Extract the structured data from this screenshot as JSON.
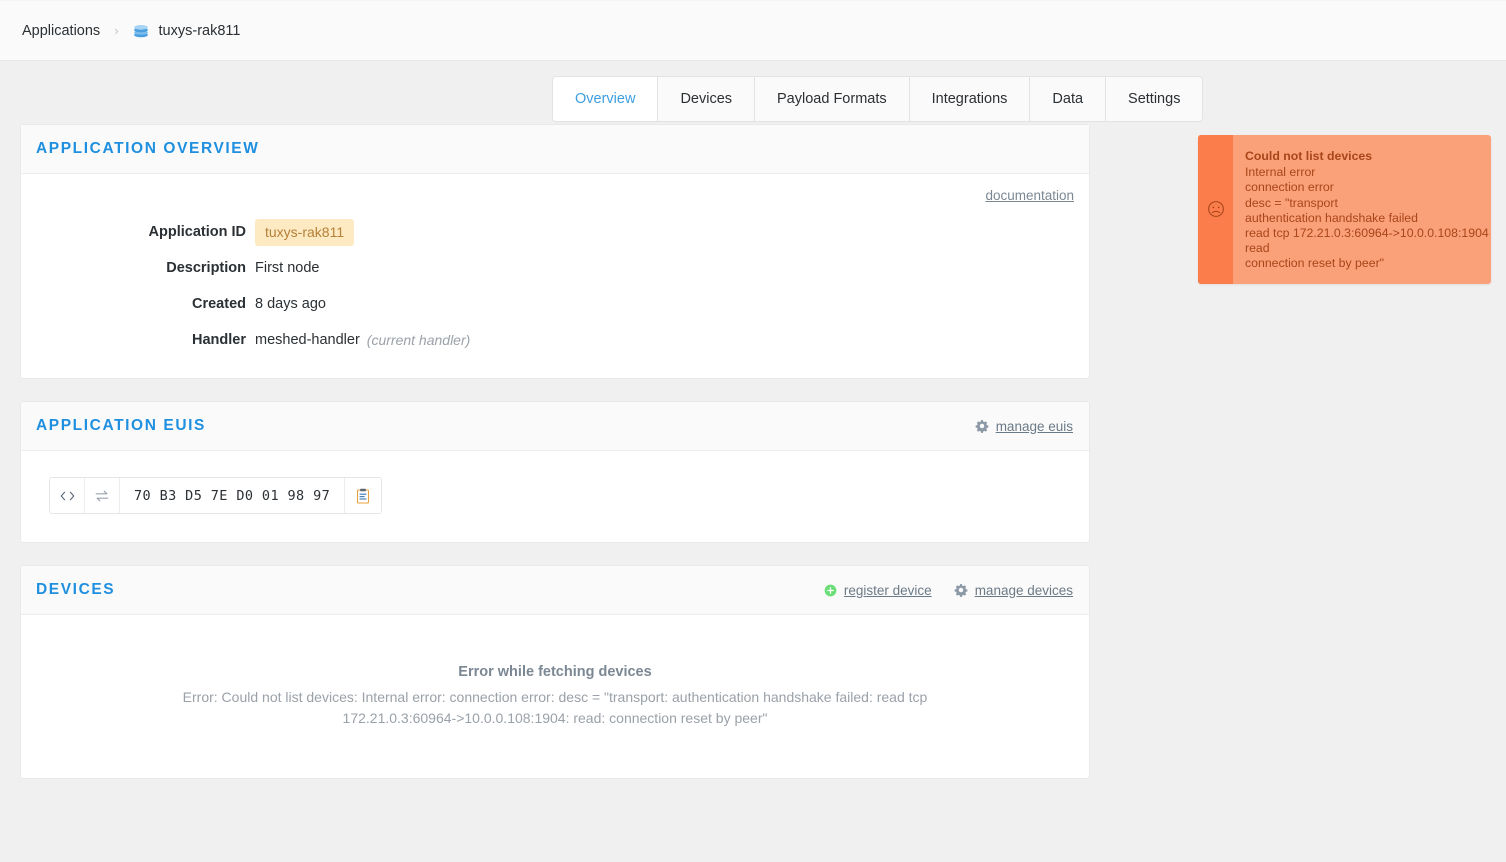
{
  "breadcrumb": {
    "root_label": "Applications",
    "separator": "›",
    "current_label": "tuxys-rak811",
    "current_icon": "layers-icon"
  },
  "tabs": [
    {
      "label": "Overview",
      "active": true
    },
    {
      "label": "Devices",
      "active": false
    },
    {
      "label": "Payload Formats",
      "active": false
    },
    {
      "label": "Integrations",
      "active": false
    },
    {
      "label": "Data",
      "active": false
    },
    {
      "label": "Settings",
      "active": false
    }
  ],
  "toast": {
    "icon": "sad-face-icon",
    "title": "Could not list devices",
    "lines": [
      "Internal error",
      "connection error",
      "desc = \"transport",
      "authentication handshake failed",
      "read tcp 172.21.0.3:60964->10.0.0.108:1904",
      "read",
      "connection reset by peer\""
    ],
    "background_color": "#fba17a",
    "accent_color": "#fa7d4b",
    "text_color": "#a8451a"
  },
  "overview_panel": {
    "title": "Application Overview",
    "documentation_link": "documentation",
    "fields": [
      {
        "key": "Application ID",
        "value": "tuxys-rak811",
        "badge": true
      },
      {
        "key": "Description",
        "value": "First node",
        "badge": false
      },
      {
        "key": "Created",
        "value": "8 days ago",
        "badge": false
      },
      {
        "key": "Handler",
        "value": "meshed-handler",
        "note": "(current handler)",
        "badge": false
      }
    ]
  },
  "euis_panel": {
    "title": "Application EUIS",
    "manage_link": {
      "label": "manage euis",
      "icon": "gear-icon"
    },
    "eui_entry": {
      "format_toggle_icon": "code-brackets-icon",
      "byte_order_icon": "swap-arrows-icon",
      "value": "70 B3 D5 7E D0 01 98 97",
      "copy_icon": "clipboard-icon"
    }
  },
  "devices_panel": {
    "title": "Devices",
    "actions": [
      {
        "label": "register device",
        "icon": "plus-circle-icon"
      },
      {
        "label": "manage devices",
        "icon": "gear-icon"
      }
    ],
    "error": {
      "title": "Error while fetching devices",
      "message": "Error: Could not list devices: Internal error: connection error: desc = \"transport: authentication handshake failed: read tcp 172.21.0.3:60964->10.0.0.108:1904: read: connection reset by peer\""
    }
  },
  "theme": {
    "page_background": "#f0f0f0",
    "panel_title_color": "#1f8fe0",
    "accent_blue": "#3e9fe0",
    "badge_background": "#fdeac2",
    "badge_text": "#b58037",
    "green": "#6ade76"
  }
}
